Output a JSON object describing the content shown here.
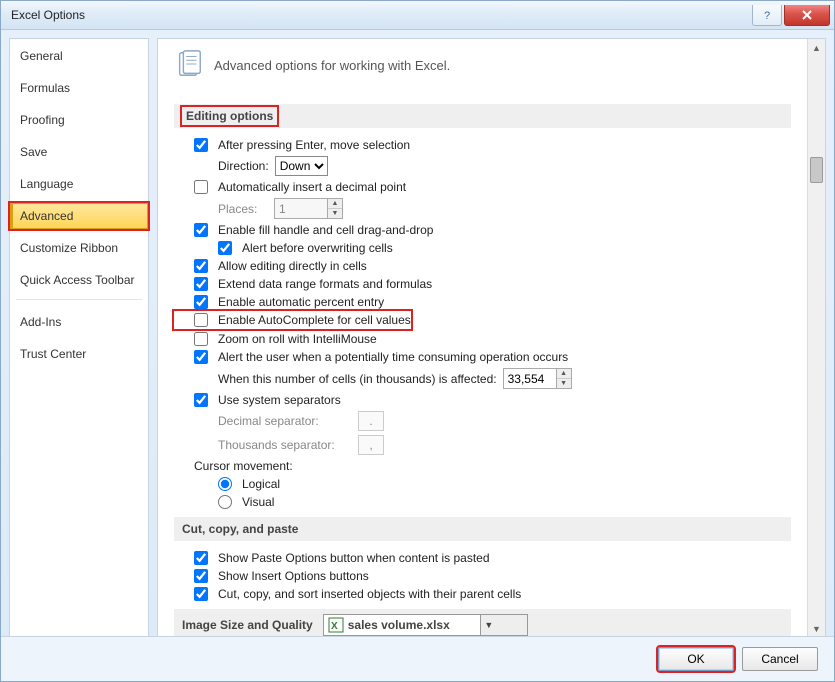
{
  "window": {
    "title": "Excel Options"
  },
  "sidebar": {
    "items": [
      {
        "label": "General"
      },
      {
        "label": "Formulas"
      },
      {
        "label": "Proofing"
      },
      {
        "label": "Save"
      },
      {
        "label": "Language"
      },
      {
        "label": "Advanced",
        "selected": true
      },
      {
        "label": "Customize Ribbon"
      },
      {
        "label": "Quick Access Toolbar"
      },
      {
        "label": "Add-Ins"
      },
      {
        "label": "Trust Center"
      }
    ]
  },
  "header": {
    "text": "Advanced options for working with Excel."
  },
  "sections": {
    "editing": {
      "title": "Editing options",
      "after_enter": "After pressing Enter, move selection",
      "direction_label": "Direction:",
      "direction_value": "Down",
      "auto_decimal": "Automatically insert a decimal point",
      "places_label": "Places:",
      "places_value": "1",
      "fill_handle": "Enable fill handle and cell drag-and-drop",
      "alert_overwrite": "Alert before overwriting cells",
      "allow_edit": "Allow editing directly in cells",
      "extend_range": "Extend data range formats and formulas",
      "auto_percent": "Enable automatic percent entry",
      "autocomplete": "Enable AutoComplete for cell values",
      "zoom_roll": "Zoom on roll with IntelliMouse",
      "alert_time": "Alert the user when a potentially time consuming operation occurs",
      "when_cells": "When this number of cells (in thousands) is affected:",
      "cells_value": "33,554",
      "use_sep": "Use system separators",
      "dec_sep_label": "Decimal separator:",
      "dec_sep_value": ".",
      "thou_sep_label": "Thousands separator:",
      "thou_sep_value": ",",
      "cursor_move": "Cursor movement:",
      "logical": "Logical",
      "visual": "Visual"
    },
    "ccp": {
      "title": "Cut, copy, and paste",
      "show_paste": "Show Paste Options button when content is pasted",
      "show_insert": "Show Insert Options buttons",
      "cut_copy_obj": "Cut, copy, and sort inserted objects with their parent cells"
    },
    "image": {
      "title": "Image Size and Quality",
      "file": "sales volume.xlsx"
    }
  },
  "footer": {
    "ok": "OK",
    "cancel": "Cancel"
  }
}
